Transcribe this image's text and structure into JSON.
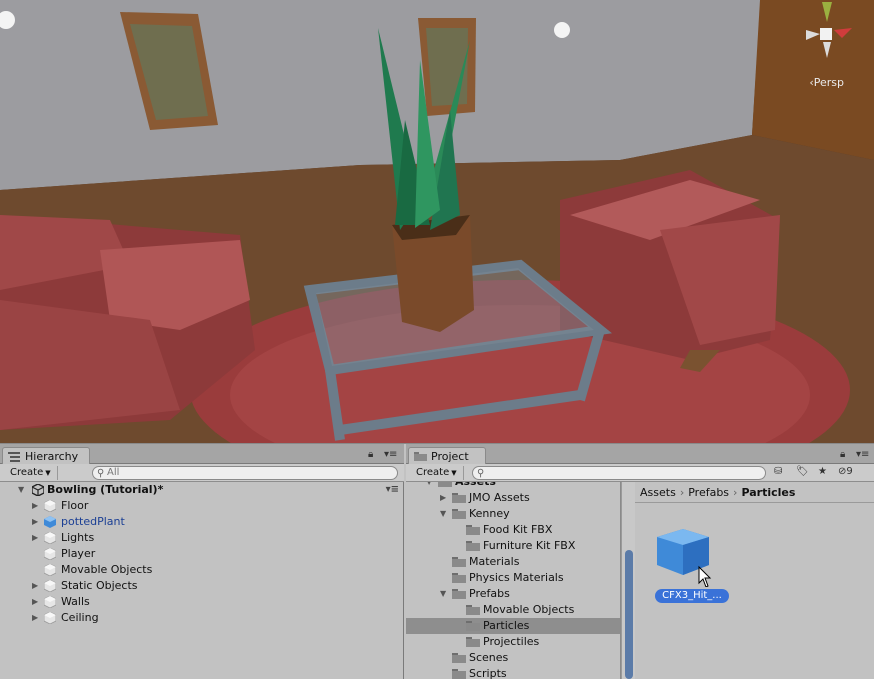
{
  "scene": {
    "persp_label": "‹Persp"
  },
  "hierarchy": {
    "tab_label": "Hierarchy",
    "create_label": "Create",
    "search_placeholder": "All",
    "scene_name": "Bowling (Tutorial)*",
    "items": [
      {
        "label": "Floor",
        "expandable": true,
        "prefab": false
      },
      {
        "label": "pottedPlant",
        "expandable": true,
        "prefab": true
      },
      {
        "label": "Lights",
        "expandable": true,
        "prefab": false
      },
      {
        "label": "Player",
        "expandable": false,
        "prefab": false
      },
      {
        "label": "Movable Objects",
        "expandable": false,
        "prefab": false
      },
      {
        "label": "Static Objects",
        "expandable": true,
        "prefab": false
      },
      {
        "label": "Walls",
        "expandable": true,
        "prefab": false
      },
      {
        "label": "Ceiling",
        "expandable": true,
        "prefab": false
      }
    ]
  },
  "project": {
    "tab_label": "Project",
    "create_label": "Create",
    "search_placeholder": "",
    "hidden_count": "9",
    "tree": [
      {
        "label": "Assets",
        "depth": 0
      },
      {
        "label": "JMO Assets",
        "depth": 1
      },
      {
        "label": "Kenney",
        "depth": 1
      },
      {
        "label": "Food Kit FBX",
        "depth": 2
      },
      {
        "label": "Furniture Kit FBX",
        "depth": 2
      },
      {
        "label": "Materials",
        "depth": 1
      },
      {
        "label": "Physics Materials",
        "depth": 1
      },
      {
        "label": "Prefabs",
        "depth": 1
      },
      {
        "label": "Movable Objects",
        "depth": 2
      },
      {
        "label": "Particles",
        "depth": 2
      },
      {
        "label": "Projectiles",
        "depth": 2
      },
      {
        "label": "Scenes",
        "depth": 1
      },
      {
        "label": "Scripts",
        "depth": 1
      }
    ],
    "breadcrumb": [
      "Assets",
      "Prefabs",
      "Particles"
    ],
    "assets": [
      {
        "label": "CFX3_Hit_..."
      }
    ]
  },
  "colors": {
    "selection_blue": "#3a72d8",
    "prefab_text": "#1b3f94",
    "tree_selected": "#8e8e8e"
  }
}
